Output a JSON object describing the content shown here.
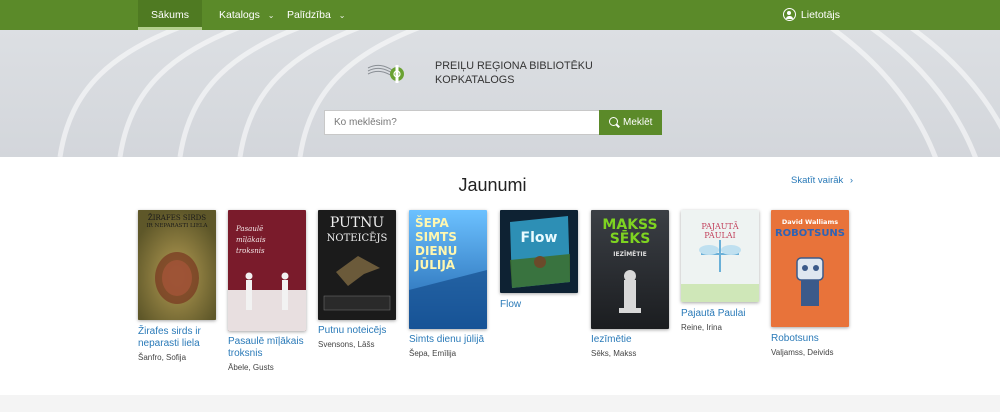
{
  "nav": {
    "items": [
      {
        "label": "Sākums"
      },
      {
        "label": "Katalogs",
        "chevron": "⌄"
      },
      {
        "label": "Palīdzība",
        "chevron": "⌄"
      }
    ],
    "user_label": "Lietotājs"
  },
  "hero": {
    "logo_line1": "PREIĻU REĢIONA BIBLIOTĒKU",
    "logo_line2": "KOPKATALOGS",
    "search_placeholder": "Ko meklēsim?",
    "search_button": "Meklēt"
  },
  "news": {
    "title": "Jaunumi",
    "see_more": "Skatīt vairāk",
    "see_more_chevron": "›",
    "books": [
      {
        "title": "Žirafes sirds ir neparasti liela",
        "author": "Šanfro, Sofija",
        "cover": {
          "bg": "#8a7f44",
          "lines": [
            "ŽIRAFES SIRDS",
            "IR NEPARASTI LIELA"
          ]
        }
      },
      {
        "title": "Pasaulē mīļākais troksnis",
        "author": "Ābele, Gusts",
        "cover": {
          "bg": "#7a1b2b",
          "lines": [
            "Pasaulē",
            "mīļākais",
            "troksnis"
          ]
        }
      },
      {
        "title": "Putnu noteicējs",
        "author": "Svensons, Lāšs",
        "cover": {
          "bg": "#1b1b1b",
          "lines": [
            "PUTNU",
            "NOTEICĒJS"
          ]
        }
      },
      {
        "title": "Simts dienu jūlijā",
        "author": "Šepa, Emīlija",
        "cover": {
          "bg": "#1e78c8",
          "lines": [
            "ŠEPA",
            "SIMTS",
            "DIENU",
            "JŪLIJĀ"
          ]
        }
      },
      {
        "title": "Flow",
        "author": "",
        "cover": {
          "bg": "#2d8fb5",
          "lines": [
            "Flow"
          ]
        }
      },
      {
        "title": "Iezīmētie",
        "author": "Sēks, Makss",
        "cover": {
          "bg": "#2b2e33",
          "lines": [
            "MAKSS",
            "SĒKS",
            "IEZĪMĒTIE"
          ]
        }
      },
      {
        "title": "Pajautā Paulai",
        "author": "Reine, Irina",
        "cover": {
          "bg": "#eef3f2",
          "lines": [
            "PAJAUTĀ",
            "PAULAI"
          ]
        }
      },
      {
        "title": "Robotsuns",
        "author": "Valjamss, Deivids",
        "cover": {
          "bg": "#e8733a",
          "lines": [
            "David Walliams",
            "ROBOTSUNS"
          ]
        }
      }
    ]
  }
}
